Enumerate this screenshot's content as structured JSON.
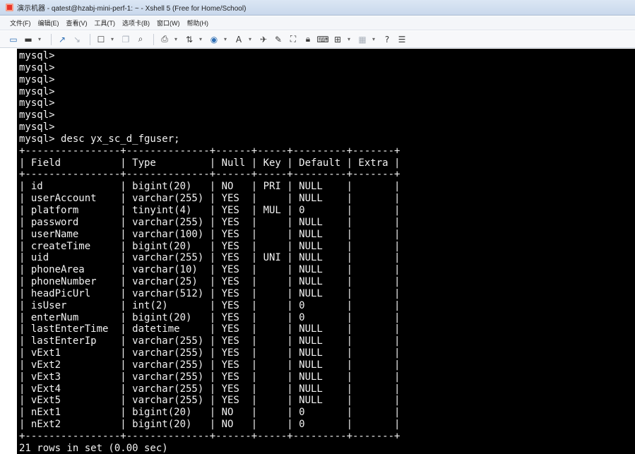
{
  "window": {
    "title": "演示机器 - qatest@hzabj-mini-perf-1: ~ - Xshell 5 (Free for Home/School)"
  },
  "menu": [
    {
      "label": "文件(F)"
    },
    {
      "label": "编辑(E)"
    },
    {
      "label": "查看(V)"
    },
    {
      "label": "工具(T)"
    },
    {
      "label": "选项卡(B)"
    },
    {
      "label": "窗口(W)"
    },
    {
      "label": "帮助(H)"
    }
  ],
  "toolbar": {
    "icons": [
      "new-session-icon",
      "open-folder-icon",
      "dropdown-icon",
      "connect-icon",
      "disconnect-icon",
      "session-properties-icon",
      "dropdown-icon",
      "copy-icon",
      "find-icon",
      "print-icon",
      "dropdown-icon",
      "transfer-icon",
      "dropdown-icon",
      "globe-icon",
      "dropdown-icon",
      "font-icon",
      "dropdown-icon",
      "xftp-icon",
      "record-icon",
      "fullscreen-icon",
      "lock-icon",
      "keyboard-icon",
      "add-tab-icon",
      "dropdown-icon",
      "layout-icon",
      "dropdown-icon",
      "help-icon",
      "chat-icon"
    ]
  },
  "terminal": {
    "lines": [
      "mysql>",
      "mysql>",
      "mysql>",
      "mysql>",
      "mysql>",
      "mysql>",
      "mysql>",
      "mysql> desc yx_sc_d_fguser;",
      "+----------------+--------------+------+-----+---------+-------+",
      "| Field          | Type         | Null | Key | Default | Extra |",
      "+----------------+--------------+------+-----+---------+-------+",
      "| id             | bigint(20)   | NO   | PRI | NULL    |       |",
      "| userAccount    | varchar(255) | YES  |     | NULL    |       |",
      "| platform       | tinyint(4)   | YES  | MUL | 0       |       |",
      "| password       | varchar(255) | YES  |     | NULL    |       |",
      "| userName       | varchar(100) | YES  |     | NULL    |       |",
      "| createTime     | bigint(20)   | YES  |     | NULL    |       |",
      "| uid            | varchar(255) | YES  | UNI | NULL    |       |",
      "| phoneArea      | varchar(10)  | YES  |     | NULL    |       |",
      "| phoneNumber    | varchar(25)  | YES  |     | NULL    |       |",
      "| headPicUrl     | varchar(512) | YES  |     | NULL    |       |",
      "| isUser         | int(2)       | YES  |     | 0       |       |",
      "| enterNum       | bigint(20)   | YES  |     | 0       |       |",
      "| lastEnterTime  | datetime     | YES  |     | NULL    |       |",
      "| lastEnterIp    | varchar(255) | YES  |     | NULL    |       |",
      "| vExt1          | varchar(255) | YES  |     | NULL    |       |",
      "| vExt2          | varchar(255) | YES  |     | NULL    |       |",
      "| vExt3          | varchar(255) | YES  |     | NULL    |       |",
      "| vExt4          | varchar(255) | YES  |     | NULL    |       |",
      "| vExt5          | varchar(255) | YES  |     | NULL    |       |",
      "| nExt1          | bigint(20)   | NO   |     | 0       |       |",
      "| nExt2          | bigint(20)   | NO   |     | 0       |       |",
      "+----------------+--------------+------+-----+---------+-------+",
      "21 rows in set (0.00 sec)"
    ]
  },
  "colors": {
    "terminal_background": "#000000",
    "terminal_text": "#f2f2f2",
    "titlebar": "#c9d8ec"
  }
}
